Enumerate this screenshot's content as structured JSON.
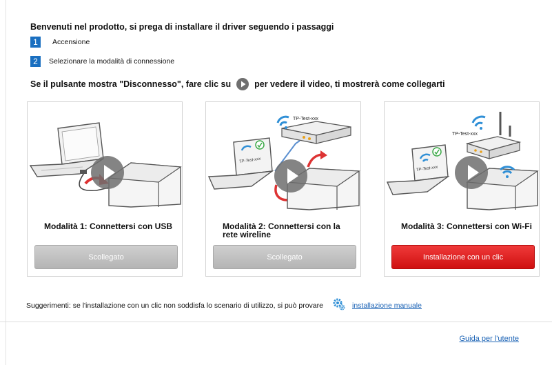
{
  "title": "Benvenuti nel prodotto, si prega di installare il driver seguendo i passaggi",
  "steps": [
    {
      "num": "1",
      "label": "Accensione"
    },
    {
      "num": "2",
      "label": "Selezionare la modalità di connessione"
    }
  ],
  "hint": {
    "before": "Se il pulsante mostra \"Disconnesso\", fare clic su",
    "after": "per vedere il video, ti mostrerà come collegarti"
  },
  "modes": [
    {
      "label": "Modalità 1: Connettersi con USB",
      "button": "Scollegato",
      "state": "disabled"
    },
    {
      "label": "Modalità 2: Connettersi con la rete wireline",
      "button": "Scollegato",
      "state": "disabled",
      "network_tag": "TP-Test-xxx",
      "laptop_tag": "TP-Test-xxx"
    },
    {
      "label": "Modalità 3: Connettersi con Wi-Fi",
      "button": "Installazione con un clic",
      "state": "active",
      "network_tag": "TP-Test-xxx",
      "laptop_tag": "TP-Test-xxx"
    }
  ],
  "suggestion": {
    "text": "Suggerimenti: se l'installazione con un clic non soddisfa lo scenario di utilizzo, si può provare",
    "link": "installazione manuale"
  },
  "footer": {
    "link": "Guida per l'utente"
  },
  "colors": {
    "accent": "#1a6fc0",
    "primary_button": "#e01e1e",
    "disabled_button": "#bdbdbd",
    "link": "#1a62b5"
  },
  "icons": {
    "play": "play-icon",
    "settings": "gear-icon"
  }
}
